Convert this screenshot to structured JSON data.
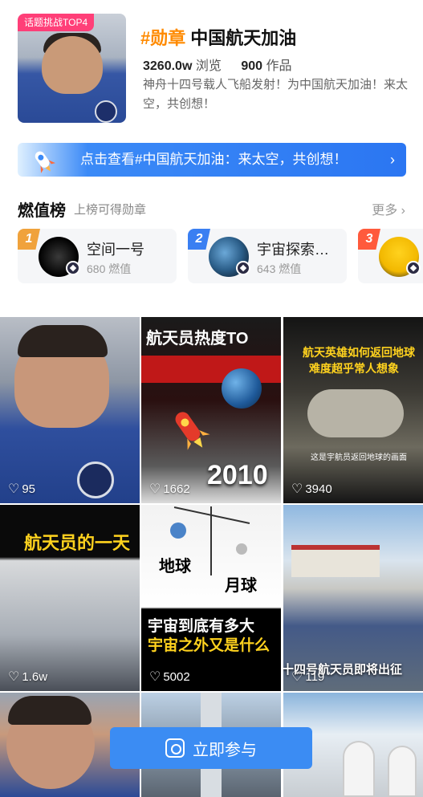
{
  "header": {
    "badge": "话题挑战TOP4",
    "hashtag": "#勋章",
    "title": "中国航天加油",
    "views_value": "3260.0w",
    "views_label": "浏览",
    "works_value": "900",
    "works_label": "作品",
    "description": "神舟十四号载人飞船发射！为中国航天加油！来太空，共创想！"
  },
  "banner": {
    "text": "点击查看#中国航天加油：来太空，共创想！",
    "arrow": "›"
  },
  "ranking": {
    "title": "燃值榜",
    "subtitle": "上榜可得勋章",
    "more": "更多 ›",
    "items": [
      {
        "rank": "1",
        "name": "空间一号",
        "value": "680 燃值",
        "color": "#f0a23c"
      },
      {
        "rank": "2",
        "name": "宇宙探索…",
        "value": "643 燃值",
        "color": "#3a7ff2"
      },
      {
        "rank": "3",
        "name": "",
        "value": "",
        "color": "#ff5a3c"
      }
    ]
  },
  "tiles": [
    {
      "likes": "95"
    },
    {
      "likes": "1662",
      "caption_top": "航天员热度TO",
      "caption_big": "2010"
    },
    {
      "likes": "3940",
      "caption_line1": "航天英雄如何返回地球",
      "caption_line2": "难度超乎常人想象",
      "caption_small": "这是宇航员返回地球的画面"
    },
    {
      "likes": "1.6w",
      "caption": "航天员的一天"
    },
    {
      "likes": "5002",
      "caption_label1": "地球",
      "caption_label2": "月球",
      "caption_line1": "宇宙到底有多大",
      "caption_line2": "宇宙之外又是什么"
    },
    {
      "likes": "119",
      "caption": "十四号航天员即将出征"
    },
    {
      "likes": ""
    },
    {
      "likes": ""
    },
    {
      "likes": ""
    }
  ],
  "cta": {
    "label": "立即参与"
  },
  "icons": {
    "heart": "♡"
  }
}
